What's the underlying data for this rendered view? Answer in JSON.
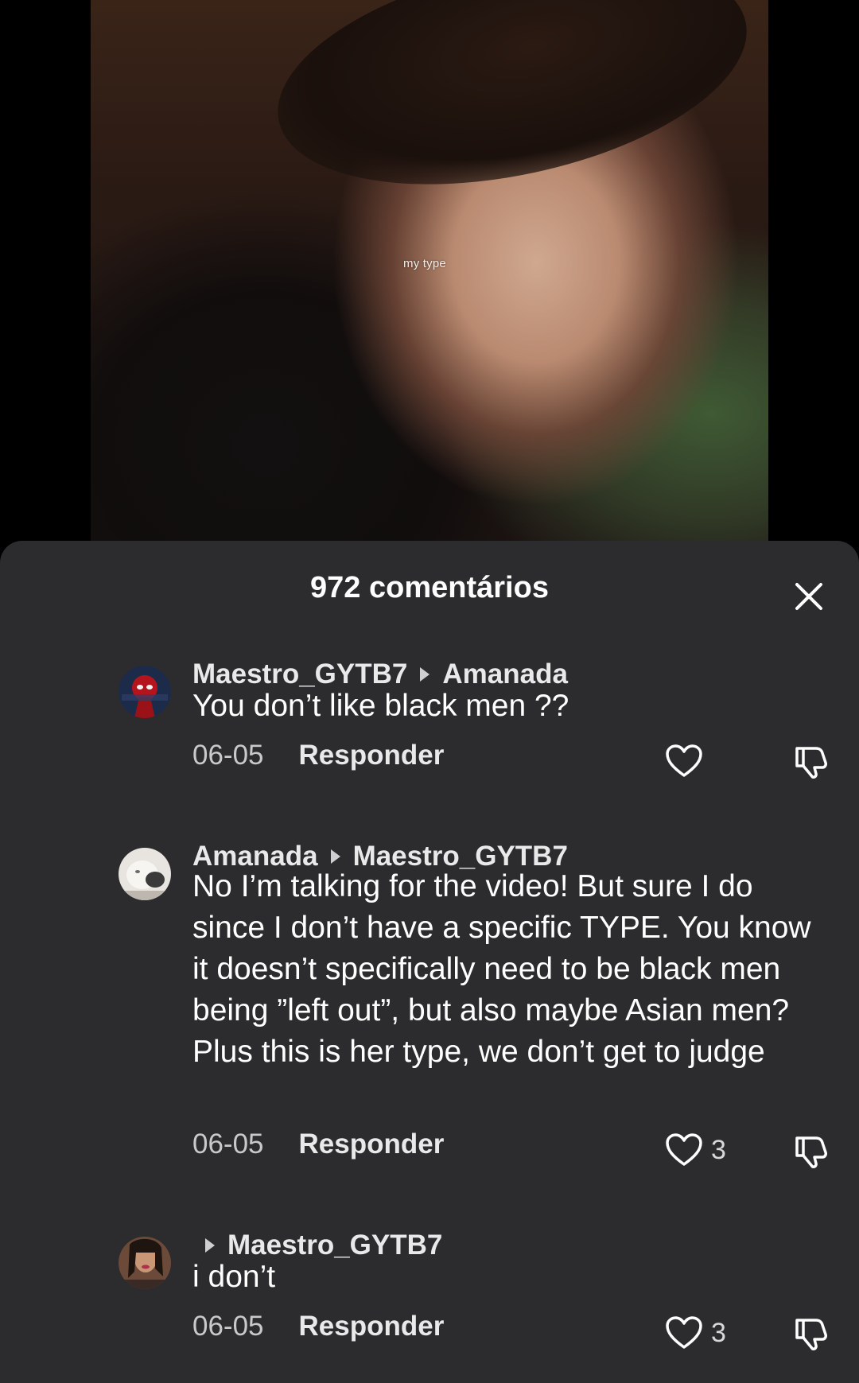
{
  "video": {
    "caption": "my type"
  },
  "sheet": {
    "title": "972 comentários",
    "close_icon": "close-icon"
  },
  "comments": [
    {
      "author": "Maestro_GYTB7",
      "reply_to": "Amanada",
      "text": "You don’t like black men ??",
      "date": "06-05",
      "reply_label": "Responder",
      "likes": ""
    },
    {
      "author": "Amanada",
      "reply_to": "Maestro_GYTB7",
      "text": "No I’m talking for the video! But sure I do since I don’t have a specific TYPE. You know it doesn’t specifically need to be black men being ”left out”, but also maybe Asian men? Plus this is her type, we don’t get to judge",
      "date": "06-05",
      "reply_label": "Responder",
      "likes": "3"
    },
    {
      "author": "",
      "reply_to": "Maestro_GYTB7",
      "text": "i don’t",
      "date": "06-05",
      "reply_label": "Responder",
      "likes": "3"
    }
  ],
  "colors": {
    "sheet_background": "#2c2c2e",
    "text_primary": "#ffffff",
    "text_secondary": "#c9c9cb"
  }
}
